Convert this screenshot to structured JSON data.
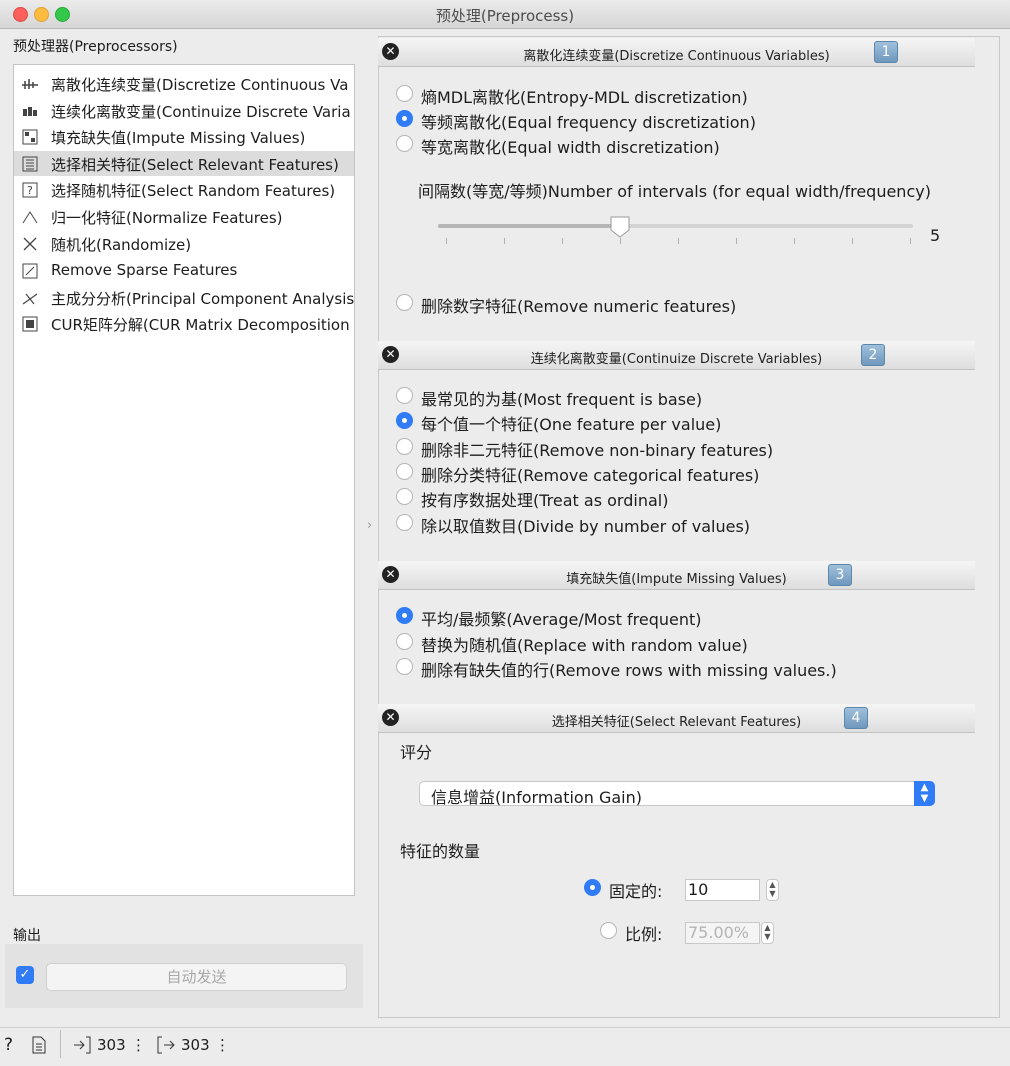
{
  "window": {
    "title": "预处理(Preprocess)"
  },
  "left": {
    "preprocessors_label": "预处理器(Preprocessors)",
    "items": [
      {
        "label": "离散化连续变量(Discretize Continuous Va",
        "icon": "discretize-icon"
      },
      {
        "label": "连续化离散变量(Continuize Discrete Varia",
        "icon": "continuize-icon"
      },
      {
        "label": "填充缺失值(Impute Missing Values)",
        "icon": "impute-icon"
      },
      {
        "label": "选择相关特征(Select Relevant Features)",
        "icon": "select-relevant-icon",
        "selected": true
      },
      {
        "label": "选择随机特征(Select Random Features)",
        "icon": "random-features-icon"
      },
      {
        "label": "归一化特征(Normalize Features)",
        "icon": "normalize-icon"
      },
      {
        "label": "随机化(Randomize)",
        "icon": "randomize-icon"
      },
      {
        "label": "Remove Sparse Features",
        "icon": "sparse-icon"
      },
      {
        "label": "主成分分析(Principal Component Analysis",
        "icon": "pca-icon"
      },
      {
        "label": "CUR矩阵分解(CUR Matrix Decomposition",
        "icon": "cur-icon"
      }
    ],
    "output_label": "输出",
    "auto_send_label": "自动发送",
    "auto_send_checked": true
  },
  "sections": [
    {
      "number": "1",
      "title": "离散化连续变量(Discretize Continuous Variables)",
      "options": [
        {
          "label": "熵MDL离散化(Entropy-MDL discretization)",
          "checked": false
        },
        {
          "label": "等频离散化(Equal frequency discretization)",
          "checked": true
        },
        {
          "label": "等宽离散化(Equal width discretization)",
          "checked": false
        }
      ],
      "intervals_label": "间隔数(等宽/等频)Number of intervals (for equal width/frequency)",
      "intervals_value": "5",
      "slider_fraction": 0.38,
      "remove_numeric_label": "删除数字特征(Remove numeric features)",
      "remove_numeric_checked": false
    },
    {
      "number": "2",
      "title": "连续化离散变量(Continuize Discrete Variables)",
      "options": [
        {
          "label": "最常见的为基(Most frequent is base)",
          "checked": false
        },
        {
          "label": "每个值一个特征(One feature per value)",
          "checked": true
        },
        {
          "label": "删除非二元特征(Remove non-binary features)",
          "checked": false
        },
        {
          "label": "删除分类特征(Remove categorical features)",
          "checked": false
        },
        {
          "label": "按有序数据处理(Treat as ordinal)",
          "checked": false
        },
        {
          "label": "除以取值数目(Divide by number of values)",
          "checked": false
        }
      ]
    },
    {
      "number": "3",
      "title": "填充缺失值(Impute Missing Values)",
      "options": [
        {
          "label": "平均/最频繁(Average/Most frequent)",
          "checked": true
        },
        {
          "label": "替换为随机值(Replace with random value)",
          "checked": false
        },
        {
          "label": "删除有缺失值的行(Remove rows with missing values.)",
          "checked": false
        }
      ]
    },
    {
      "number": "4",
      "title": "选择相关特征(Select Relevant Features)",
      "score_label": "评分",
      "score_value": "信息增益(Information Gain)",
      "nfeat_label": "特征的数量",
      "fixed_label": "固定的:",
      "fixed_value": "10",
      "fixed_checked": true,
      "ratio_label": "比例:",
      "ratio_value": "75.00%",
      "ratio_checked": false
    }
  ],
  "status": {
    "input_count": "303",
    "output_count": "303"
  },
  "colors": {
    "accent": "#2f7cf6",
    "section_number": "#7fa7c9"
  }
}
